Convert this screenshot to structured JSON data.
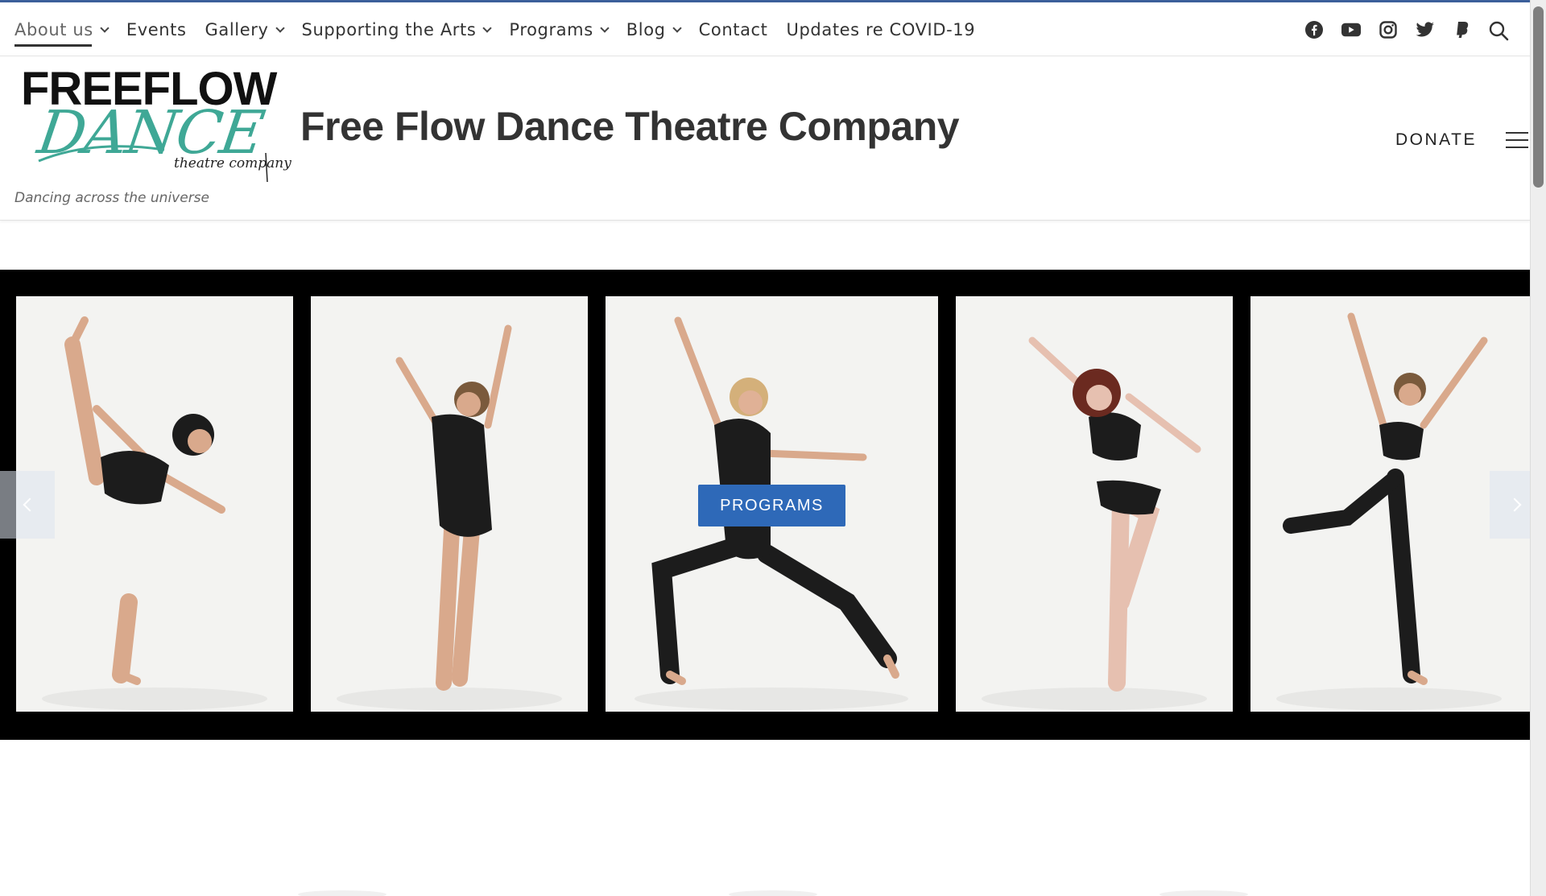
{
  "nav": {
    "items": [
      {
        "label": "About us",
        "has_dropdown": true,
        "active": true
      },
      {
        "label": "Events",
        "has_dropdown": false
      },
      {
        "label": "Gallery",
        "has_dropdown": true
      },
      {
        "label": "Supporting the Arts",
        "has_dropdown": true
      },
      {
        "label": "Programs",
        "has_dropdown": true
      },
      {
        "label": "Blog",
        "has_dropdown": true
      },
      {
        "label": "Contact",
        "has_dropdown": false
      },
      {
        "label": "Updates re COVID-19",
        "has_dropdown": false
      }
    ],
    "social_icons": [
      "facebook-icon",
      "youtube-icon",
      "instagram-icon",
      "twitter-icon",
      "paypal-icon"
    ],
    "search_icon": "search-icon"
  },
  "header": {
    "logo": {
      "line1": "FREEFLOW",
      "line2": "DANCE",
      "line3": "theatre company"
    },
    "site_title": "Free Flow Dance Theatre Company",
    "tagline": "Dancing across the universe",
    "donate_label": "DONATE",
    "menu_icon": "hamburger-icon"
  },
  "carousel": {
    "cta_label": "PROGRAMS",
    "prev_icon": "chevron-left-icon",
    "next_icon": "chevron-right-icon",
    "slides": [
      {
        "subject": "dancer-leg-extension"
      },
      {
        "subject": "dancer-arms-raised"
      },
      {
        "subject": "dancer-lunge"
      },
      {
        "subject": "dancer-knee-raise"
      },
      {
        "subject": "dancer-arabesque"
      }
    ]
  },
  "colors": {
    "accent": "#3b5f9a",
    "button": "#2e69b8",
    "logo_teal": "#3fa896",
    "carousel_bg": "#000000"
  }
}
